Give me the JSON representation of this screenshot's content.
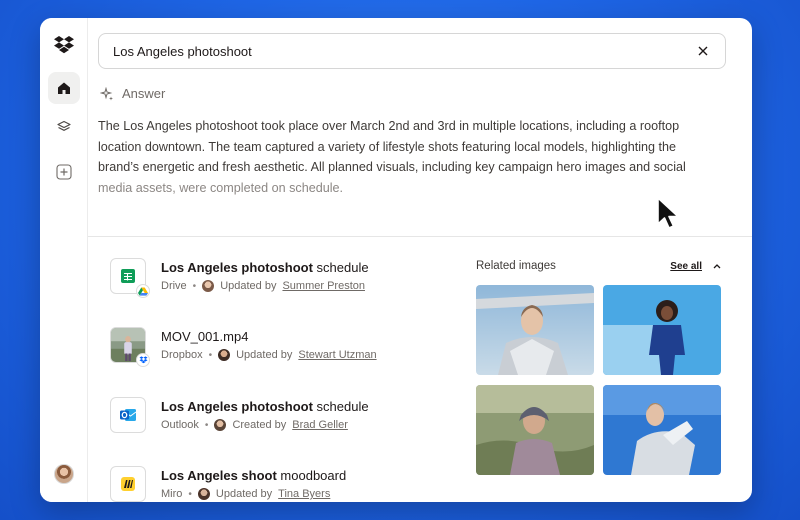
{
  "search": {
    "query": "Los Angeles photoshoot"
  },
  "answer": {
    "label": "Answer",
    "line1": "The Los Angeles photoshoot took place over March 2nd and 3rd in multiple locations, including a rooftop",
    "line2": "location downtown. The team captured a variety of lifestyle shots featuring local models, highlighting the",
    "line3": "brand’s energetic and fresh aesthetic. All planned visuals, including key campaign hero images and social",
    "line4": "media assets, were completed on schedule."
  },
  "files": [
    {
      "title_bold": "Los Angeles photoshoot",
      "title_rest": " schedule",
      "source": "Drive",
      "action": "Updated by",
      "person": "Summer Preston",
      "icon": "google-sheets-icon"
    },
    {
      "title_bold": "",
      "title_rest": "MOV_001.mp4",
      "source": "Dropbox",
      "action": "Updated by",
      "person": "Stewart Utzman",
      "icon": "video-thumbnail"
    },
    {
      "title_bold": "Los Angeles photoshoot",
      "title_rest": " schedule",
      "source": "Outlook",
      "action": "Created by",
      "person": "Brad Geller",
      "icon": "outlook-icon"
    },
    {
      "title_bold": "Los Angeles shoot",
      "title_rest": " moodboard",
      "source": "Miro",
      "action": "Updated by",
      "person": "Tina Byers",
      "icon": "miro-icon"
    }
  ],
  "related": {
    "label": "Related images",
    "see_all": "See all"
  },
  "colors": {
    "background": "#1f66e6",
    "sheets": "#0f9d58",
    "outlook": "#0a64c8",
    "miro": "#ffd02f",
    "dropbox": "#0061fe"
  }
}
